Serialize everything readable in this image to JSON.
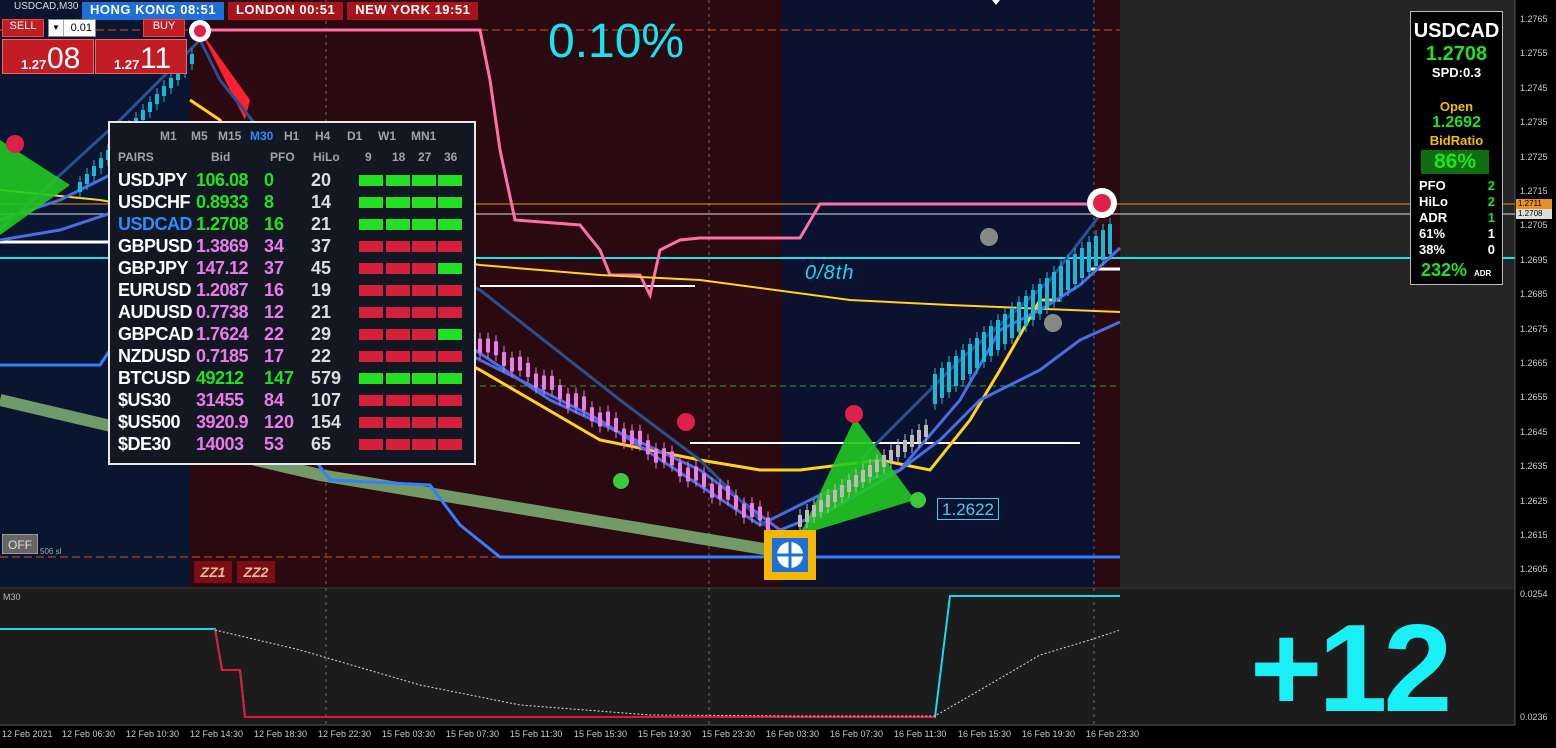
{
  "window": {
    "title": "USDCAD,M30"
  },
  "sessions": [
    {
      "label": "HONG KONG 08:51"
    },
    {
      "label": "LONDON  00:51"
    },
    {
      "label": "NEW YORK  19:51"
    }
  ],
  "trade": {
    "sell_label": "SELL",
    "buy_label": "BUY",
    "lot_value": "0.01",
    "sell_price_prefix": "1.27",
    "sell_price_big": "08",
    "buy_price_prefix": "1.27",
    "buy_price_big": "11"
  },
  "overlay": {
    "percent": "0.10%",
    "score": "+12",
    "eighth_label": "0/8th",
    "level_box": "1.2622",
    "off_button": "OFF",
    "off_text": "506 sl",
    "zz1": "ZZ1",
    "zz2": "ZZ2",
    "subwindow_label": "M30"
  },
  "dashboard": {
    "timeframes": [
      "M1",
      "M5",
      "M15",
      "M30",
      "H1",
      "H4",
      "D1",
      "W1",
      "MN1"
    ],
    "active_timeframe": "M30",
    "headers": {
      "pairs": "PAIRS",
      "bid": "Bid",
      "pfo": "PFO",
      "hilo": "HiLo",
      "p9": "9",
      "p18": "18",
      "p27": "27",
      "p36": "36"
    },
    "rows": [
      {
        "pair": "USDJPY",
        "bid": "106.08",
        "pfo": "0",
        "hilo": "20",
        "bid_color": "#22e022",
        "pfo_color": "#22e022",
        "bars": [
          "g",
          "g",
          "g",
          "g"
        ]
      },
      {
        "pair": "USDCHF",
        "bid": "0.8933",
        "pfo": "8",
        "hilo": "14",
        "bid_color": "#22e022",
        "pfo_color": "#22e022",
        "bars": [
          "g",
          "g",
          "g",
          "g"
        ]
      },
      {
        "pair": "USDCAD",
        "bid": "1.2708",
        "pfo": "16",
        "hilo": "21",
        "bid_color": "#22e022",
        "pfo_color": "#22e022",
        "bars": [
          "g",
          "g",
          "g",
          "g"
        ],
        "active": true
      },
      {
        "pair": "GBPUSD",
        "bid": "1.3869",
        "pfo": "34",
        "hilo": "37",
        "bid_color": "#e87ce8",
        "pfo_color": "#e87ce8",
        "bars": [
          "r",
          "r",
          "r",
          "r"
        ]
      },
      {
        "pair": "GBPJPY",
        "bid": "147.12",
        "pfo": "37",
        "hilo": "45",
        "bid_color": "#e87ce8",
        "pfo_color": "#e87ce8",
        "bars": [
          "r",
          "r",
          "r",
          "g"
        ]
      },
      {
        "pair": "EURUSD",
        "bid": "1.2087",
        "pfo": "16",
        "hilo": "19",
        "bid_color": "#e87ce8",
        "pfo_color": "#e87ce8",
        "bars": [
          "r",
          "r",
          "r",
          "r"
        ]
      },
      {
        "pair": "AUDUSD",
        "bid": "0.7738",
        "pfo": "12",
        "hilo": "21",
        "bid_color": "#e87ce8",
        "pfo_color": "#e87ce8",
        "bars": [
          "r",
          "r",
          "r",
          "r"
        ]
      },
      {
        "pair": "GBPCAD",
        "bid": "1.7624",
        "pfo": "22",
        "hilo": "29",
        "bid_color": "#e87ce8",
        "pfo_color": "#e87ce8",
        "bars": [
          "r",
          "r",
          "r",
          "g"
        ]
      },
      {
        "pair": "NZDUSD",
        "bid": "0.7185",
        "pfo": "17",
        "hilo": "22",
        "bid_color": "#e87ce8",
        "pfo_color": "#e87ce8",
        "bars": [
          "r",
          "r",
          "r",
          "r"
        ]
      },
      {
        "pair": "BTCUSD",
        "bid": "49212",
        "pfo": "147",
        "hilo": "579",
        "bid_color": "#22e022",
        "pfo_color": "#22e022",
        "bars": [
          "g",
          "g",
          "g",
          "g"
        ]
      },
      {
        "pair": "$US30",
        "bid": "31455",
        "pfo": "84",
        "hilo": "107",
        "bid_color": "#e87ce8",
        "pfo_color": "#e87ce8",
        "bars": [
          "r",
          "r",
          "r",
          "r"
        ]
      },
      {
        "pair": "$US500",
        "bid": "3920.9",
        "pfo": "120",
        "hilo": "154",
        "bid_color": "#e87ce8",
        "pfo_color": "#e87ce8",
        "bars": [
          "r",
          "r",
          "r",
          "r"
        ]
      },
      {
        "pair": "$DE30",
        "bid": "14003",
        "pfo": "53",
        "hilo": "65",
        "bid_color": "#e87ce8",
        "pfo_color": "#e87ce8",
        "bars": [
          "r",
          "r",
          "r",
          "r"
        ]
      }
    ]
  },
  "info_panel": {
    "symbol": "USDCAD",
    "bid": "1.2708",
    "spread": "SPD:0.3",
    "open_label": "Open",
    "open_value": "1.2692",
    "bidratio_label": "BidRatio",
    "bidratio_value": "86%",
    "stats": [
      {
        "label": "PFO",
        "value": "2",
        "color": "g"
      },
      {
        "label": "HiLo",
        "value": "2",
        "color": "g"
      },
      {
        "label": "ADR",
        "value": "1",
        "color": "g"
      },
      {
        "label": "61%",
        "value": "1",
        "color": "w"
      },
      {
        "label": "38%",
        "value": "0",
        "color": "w"
      }
    ],
    "adr_pct": "232%",
    "adr_suffix": "ADR"
  },
  "price_axis": {
    "labels": [
      "1.2765",
      "1.2755",
      "1.2745",
      "1.2735",
      "1.2725",
      "1.2715",
      "1.2705",
      "1.2695",
      "1.2685",
      "1.2675",
      "1.2665",
      "1.2655",
      "1.2645",
      "1.2635",
      "1.2625",
      "1.2615",
      "1.2605"
    ],
    "ask_tag": "1.2711",
    "bid_tag": "1.2708"
  },
  "sub_axis": {
    "top": "0.0254",
    "bottom": "0.0236"
  },
  "time_axis": [
    "12 Feb 2021",
    "12 Feb 06:30",
    "12 Feb 10:30",
    "12 Feb 14:30",
    "12 Feb 18:30",
    "12 Feb 22:30",
    "15 Feb 03:30",
    "15 Feb 07:30",
    "15 Feb 11:30",
    "15 Feb 15:30",
    "15 Feb 19:30",
    "15 Feb 23:30",
    "16 Feb 03:30",
    "16 Feb 07:30",
    "16 Feb 11:30",
    "16 Feb 15:30",
    "16 Feb 19:30",
    "16 Feb 23:30"
  ],
  "colors": {
    "bg": "#000000",
    "hk_session": "#1e6fd8",
    "session_red": "#a8141c",
    "bull_green": "#22e022",
    "bear_pink": "#e87ce8",
    "cyan": "#19e3f0",
    "ma_yellow": "#ffd21f",
    "ma_blue": "#4a6de0",
    "pink_line": "#ff6fa8"
  }
}
